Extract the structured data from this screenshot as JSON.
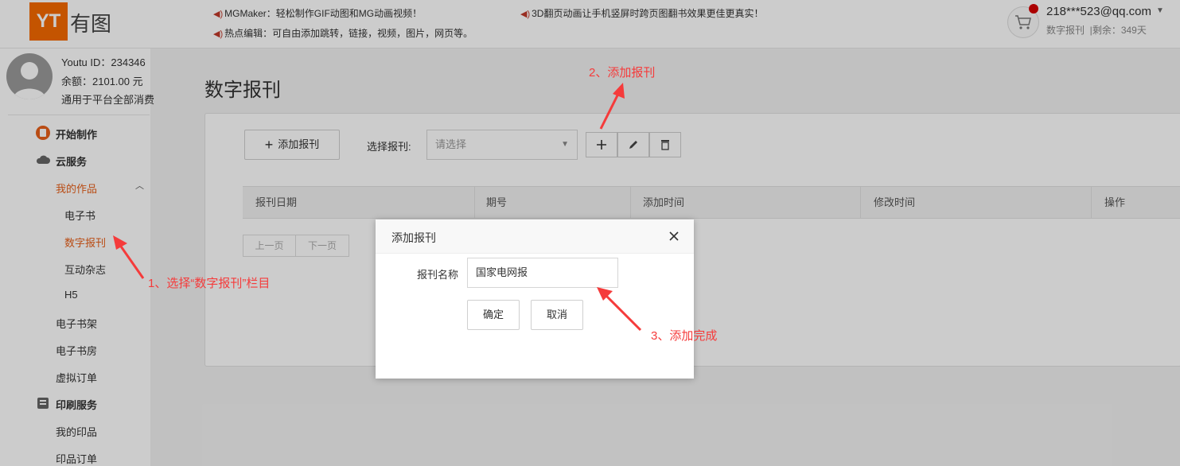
{
  "header": {
    "logo_mark": "YT",
    "logo_text": "有图",
    "notices": [
      "MGMaker：轻松制作GIF动图和MG动画视频！",
      "热点编辑：可自由添加跳转，链接，视频，图片，网页等。",
      "3D翻页动画让手机竖屏时跨页图翻书效果更佳更真实！"
    ],
    "user": {
      "email": "218***523@qq.com",
      "product": "数字报刊",
      "remaining": "剩余：349天"
    }
  },
  "profile": {
    "id_line": "Youtu ID：234346",
    "balance_line": "余额：2101.00 元",
    "usage_note": "通用于平台全部消费"
  },
  "sidebar": {
    "start": "开始制作",
    "cloud": "云服务",
    "my_works": "我的作品",
    "ebook": "电子书",
    "digital_paper": "数字报刊",
    "interactive_mag": "互动杂志",
    "h5": "H5",
    "ebook_shelf": "电子书架",
    "ebook_room": "电子书房",
    "virtual_order": "虚拟订单",
    "print_service": "印刷服务",
    "my_prints": "我的印品",
    "print_orders": "印品订单"
  },
  "main": {
    "title": "数字报刊",
    "add_button": "添加报刊",
    "select_label": "选择报刊:",
    "select_placeholder": "请选择",
    "columns": [
      "报刊日期",
      "期号",
      "添加时间",
      "修改时间",
      "操作"
    ],
    "prev": "上一页",
    "next": "下一页"
  },
  "modal": {
    "title": "添加报刊",
    "field_label": "报刊名称",
    "field_value": "国家电网报",
    "ok": "确定",
    "cancel": "取消"
  },
  "annotations": {
    "step1": "1、选择“数字报刊”栏目",
    "step2": "2、添加报刊",
    "step3": "3、添加完成"
  },
  "colors": {
    "accent": "#e8601a",
    "annotation": "#f53b3b",
    "logo_bg": "#f56a00"
  }
}
